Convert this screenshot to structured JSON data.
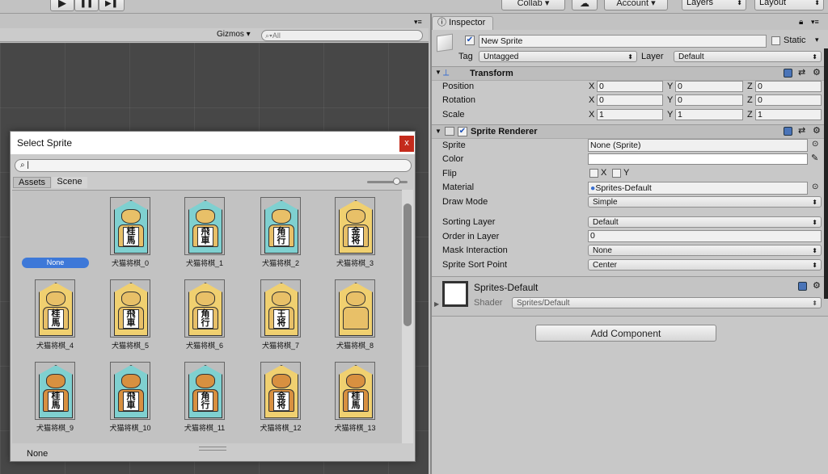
{
  "toolbar": {
    "play": "▶",
    "pause": "❚❚",
    "step": "▶❚",
    "collab": "Collab ▾",
    "account": "Account ▾",
    "layers": "Layers",
    "layout": "Layout"
  },
  "scene": {
    "gizmos": "Gizmos ▾",
    "search_placeholder": "All"
  },
  "inspector": {
    "tab": "Inspector",
    "name": "New Sprite",
    "static": "Static",
    "tag_label": "Tag",
    "tag_value": "Untagged",
    "layer_label": "Layer",
    "layer_value": "Default",
    "transform": {
      "title": "Transform",
      "rows": [
        {
          "label": "Position",
          "x": "0",
          "y": "0",
          "z": "0"
        },
        {
          "label": "Rotation",
          "x": "0",
          "y": "0",
          "z": "0"
        },
        {
          "label": "Scale",
          "x": "1",
          "y": "1",
          "z": "1"
        }
      ]
    },
    "sprite_renderer": {
      "title": "Sprite Renderer",
      "sprite_label": "Sprite",
      "sprite_value": "None (Sprite)",
      "color_label": "Color",
      "flip_label": "Flip",
      "flip_x": "X",
      "flip_y": "Y",
      "material_label": "Material",
      "material_value": "Sprites-Default",
      "draw_mode_label": "Draw Mode",
      "draw_mode_value": "Simple",
      "sorting_layer_label": "Sorting Layer",
      "sorting_layer_value": "Default",
      "order_label": "Order in Layer",
      "order_value": "0",
      "mask_label": "Mask Interaction",
      "mask_value": "None",
      "sort_point_label": "Sprite Sort Point",
      "sort_point_value": "Center"
    },
    "material": {
      "name": "Sprites-Default",
      "shader_label": "Shader",
      "shader_value": "Sprites/Default"
    },
    "add_component": "Add Component"
  },
  "dialog": {
    "title": "Select Sprite",
    "close": "x",
    "tabs": [
      "Assets",
      "Scene"
    ],
    "none_label": "None",
    "status": "None",
    "items": [
      {
        "name": "犬猫将棋_0",
        "bg": "#7fd0d0",
        "animal": "#e8c068",
        "text": "桂\n馬"
      },
      {
        "name": "犬猫将棋_1",
        "bg": "#7fd0d0",
        "animal": "#e8c068",
        "text": "飛\n車"
      },
      {
        "name": "犬猫将棋_2",
        "bg": "#7fd0d0",
        "animal": "#e8c068",
        "text": "角\n行"
      },
      {
        "name": "犬猫将棋_3",
        "bg": "#f0d070",
        "animal": "#e8c068",
        "text": "金\n将"
      },
      {
        "name": "犬猫将棋_4",
        "bg": "#f0d070",
        "animal": "#e8c068",
        "text": "桂\n馬"
      },
      {
        "name": "犬猫将棋_5",
        "bg": "#f0d070",
        "animal": "#e8c068",
        "text": "飛\n車"
      },
      {
        "name": "犬猫将棋_6",
        "bg": "#f0d070",
        "animal": "#e8c068",
        "text": "角\n行"
      },
      {
        "name": "犬猫将棋_7",
        "bg": "#f0d070",
        "animal": "#e8c068",
        "text": "王\n将"
      },
      {
        "name": "犬猫将棋_8",
        "bg": "#f0d070",
        "animal": "#e8c068",
        "text": ""
      },
      {
        "name": "犬猫将棋_9",
        "bg": "#7fd0d0",
        "animal": "#d89040",
        "text": "桂\n馬"
      },
      {
        "name": "犬猫将棋_10",
        "bg": "#7fd0d0",
        "animal": "#d89040",
        "text": "飛\n車"
      },
      {
        "name": "犬猫将棋_11",
        "bg": "#7fd0d0",
        "animal": "#d89040",
        "text": "角\n行"
      },
      {
        "name": "犬猫将棋_12",
        "bg": "#f0d070",
        "animal": "#d89040",
        "text": "金\n将"
      },
      {
        "name": "犬猫将棋_13",
        "bg": "#f0d070",
        "animal": "#d89040",
        "text": "桂\n馬"
      }
    ]
  }
}
